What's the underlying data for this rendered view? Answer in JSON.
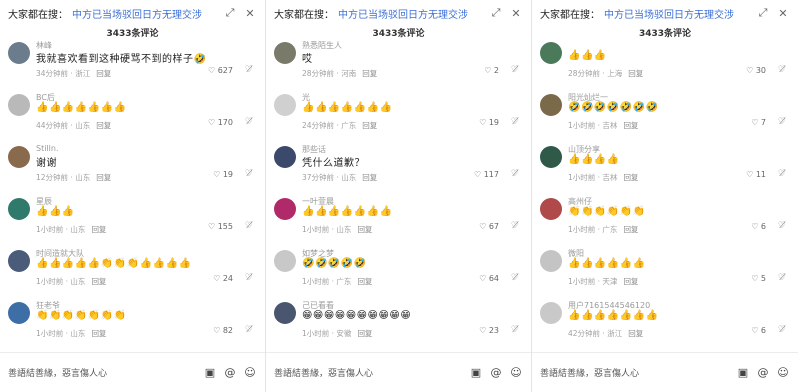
{
  "panels": [
    {
      "header": {
        "lead": "大家都在搜：",
        "topic": "中方已当场驳回日方无理交涉"
      },
      "comment_count": "3433条评论",
      "input_placeholder": "善語結善緣，惡言傷人心",
      "comments": [
        {
          "user": "林峰",
          "text": "我就喜欢看到这种硬骂不到的样子🤣",
          "meta": "34分钟前 · 浙江",
          "reply": "回复",
          "likes": "627",
          "avatar_color": "#6b7c8c"
        },
        {
          "user": "BC后",
          "text": "👍👍👍👍👍👍👍",
          "meta": "44分钟前 · 山东",
          "reply": "回复",
          "likes": "170",
          "avatar_color": "#b9b9b9"
        },
        {
          "user": "Stilln.",
          "text": "谢谢",
          "meta": "12分钟前 · 山东",
          "reply": "回复",
          "likes": "19",
          "avatar_color": "#8a6a4c"
        },
        {
          "user": "星辰",
          "text": "👍👍👍",
          "meta": "1小时前 · 山东",
          "reply": "回复",
          "likes": "155",
          "avatar_color": "#2f7a6a"
        },
        {
          "user": "时间造就大队",
          "text": "👍👍👍👍👍👏👏👏👍👍👍👍",
          "meta": "1小时前 · 山东",
          "reply": "回复",
          "likes": "24",
          "avatar_color": "#4a5c7a"
        },
        {
          "user": "狂老爷",
          "text": "👏👏👏👏👏👏👏",
          "meta": "1小时前 · 山东",
          "reply": "回复",
          "likes": "82",
          "avatar_color": "#3d6ea5"
        }
      ]
    },
    {
      "header": {
        "lead": "大家都在搜：",
        "topic": "中方已当场驳回日方无理交涉"
      },
      "comment_count": "3433条评论",
      "input_placeholder": "善語結善緣，惡言傷人心",
      "comments": [
        {
          "user": "熟悉陌生人",
          "text": "哎",
          "meta": "28分钟前 · 河南",
          "reply": "回复",
          "likes": "2",
          "avatar_color": "#7a7a6a"
        },
        {
          "user": "光",
          "text": "👍👍👍👍👍👍👍",
          "meta": "24分钟前 · 广东",
          "reply": "回复",
          "likes": "19",
          "avatar_color": "#d0d0d0"
        },
        {
          "user": "那些话",
          "text": "凭什么道歉？",
          "meta": "37分钟前 · 山东",
          "reply": "回复",
          "likes": "117",
          "avatar_color": "#3b4a6a"
        },
        {
          "user": "一叶萱晨",
          "text": "👍👍👍👍👍👍👍",
          "meta": "1小时前 · 山东",
          "reply": "回复",
          "likes": "67",
          "avatar_color": "#b02a6a"
        },
        {
          "user": "如梦之梦",
          "text": "🤣🤣🤣🤣🤣",
          "meta": "1小时前 · 广东",
          "reply": "回复",
          "likes": "64",
          "avatar_color": "#c8c8c8"
        },
        {
          "user": "己已看看",
          "text": "😁😁😁😁😁😁😁😁😁😁",
          "meta": "1小时前 · 安徽",
          "reply": "回复",
          "likes": "23",
          "avatar_color": "#4a5670"
        }
      ]
    },
    {
      "header": {
        "lead": "大家都在搜：",
        "topic": "中方已当场驳回日方无理交涉"
      },
      "comment_count": "3433条评论",
      "input_placeholder": "善語結善緣，惡言傷人心",
      "comments": [
        {
          "user": "",
          "text": "👍👍👍",
          "meta": "28分钟前 · 上海",
          "reply": "回复",
          "likes": "30",
          "avatar_color": "#4a7a5a"
        },
        {
          "user": "阳光灿烂一",
          "text": "🤣🤣🤣🤣🤣🤣🤣",
          "meta": "1小时前 · 吉林",
          "reply": "回复",
          "likes": "7",
          "avatar_color": "#7a6a4a"
        },
        {
          "user": "山顶分享",
          "text": "👍👍👍👍",
          "meta": "1小时前 · 吉林",
          "reply": "回复",
          "likes": "11",
          "avatar_color": "#2f5a4a"
        },
        {
          "user": "高州仔",
          "text": "👏👏👏👏👏👏",
          "meta": "1小时前 · 广东",
          "reply": "回复",
          "likes": "6",
          "avatar_color": "#b04a4a"
        },
        {
          "user": "微阳",
          "text": "👍👍👍👍👍👍",
          "meta": "1小时前 · 天津",
          "reply": "回复",
          "likes": "5",
          "avatar_color": "#c4c4c4"
        },
        {
          "user": "用户7161544546120",
          "text": "👍👍👍👍👍👍👍",
          "meta": "42分钟前 · 浙江",
          "reply": "回复",
          "likes": "6",
          "avatar_color": "#c9c9c9"
        }
      ]
    }
  ]
}
